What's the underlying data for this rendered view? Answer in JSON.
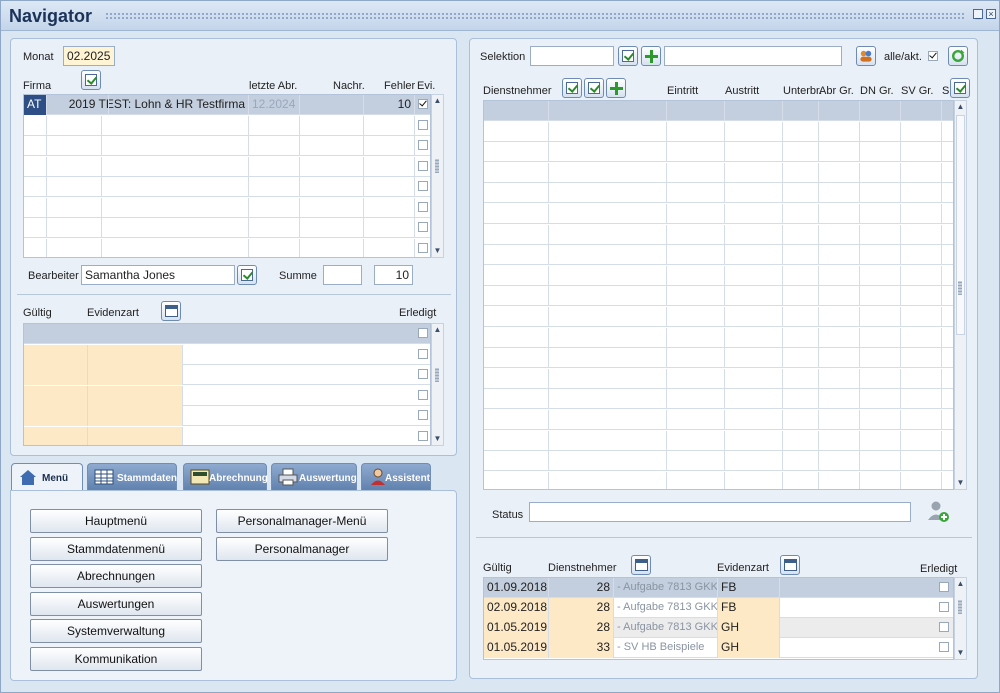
{
  "window": {
    "title": "Navigator"
  },
  "left_top": {
    "monat_label": "Monat",
    "monat_value": "02.2025",
    "columns": {
      "firma": "Firma",
      "letzte_abr": "letzte Abr.",
      "nachr": "Nachr.",
      "fehler": "Fehler",
      "evi": "Evi."
    },
    "rows": [
      {
        "land": "AT",
        "name": "2019 TEST: Lohn & HR Testfirma",
        "letzte_abr": "12.2024",
        "nachr": "",
        "fehler": "10",
        "evi_checked": true
      }
    ],
    "bearbeiter_label": "Bearbeiter",
    "bearbeiter_value": "Samantha Jones",
    "summe_label": "Summe",
    "summe_value": "",
    "summe_fehler": "10"
  },
  "left_mid": {
    "columns": {
      "gueltig": "Gültig",
      "evidenzart": "Evidenzart",
      "erledigt": "Erledigt"
    }
  },
  "tabs": [
    {
      "label": "Menü",
      "icon": "home-icon",
      "active": true
    },
    {
      "label": "Stammdaten",
      "icon": "table-icon",
      "active": false
    },
    {
      "label": "Abrechnung",
      "icon": "calculator-icon",
      "active": false
    },
    {
      "label": "Auswertung",
      "icon": "printer-icon",
      "active": false
    },
    {
      "label": "Assistent",
      "icon": "person-icon",
      "active": false
    }
  ],
  "menu": {
    "col1": [
      "Hauptmenü",
      "Stammdatenmenü",
      "Abrechnungen",
      "Auswertungen",
      "Systemverwaltung",
      "Kommunikation"
    ],
    "col2": [
      "Personalmanager-Menü",
      "Personalmanager"
    ]
  },
  "right_top": {
    "selektion_label": "Selektion",
    "selektion_value": "",
    "selektion_text": "",
    "alle_akt_label": "alle/akt.",
    "alle_akt_checked": true,
    "columns": {
      "dienstnehmer": "Dienstnehmer",
      "eintritt": "Eintritt",
      "austritt": "Austritt",
      "unterbr": "Unterbr.",
      "abr_gr": "Abr Gr.",
      "dn_gr": "DN Gr.",
      "sv_gr": "SV Gr.",
      "s": "S"
    },
    "status_label": "Status",
    "status_value": ""
  },
  "right_bottom": {
    "columns": {
      "gueltig": "Gültig",
      "dienstnehmer": "Dienstnehmer",
      "evidenzart": "Evidenzart",
      "erledigt": "Erledigt"
    },
    "rows": [
      {
        "gueltig": "01.09.2018",
        "nr": "28",
        "name": "- Aufgabe 7813 GKK",
        "art": "FB",
        "erledigt": false
      },
      {
        "gueltig": "02.09.2018",
        "nr": "28",
        "name": "- Aufgabe 7813 GKK",
        "art": "FB",
        "erledigt": false
      },
      {
        "gueltig": "01.05.2019",
        "nr": "28",
        "name": "- Aufgabe 7813 GKK",
        "art": "GH",
        "erledigt": false
      },
      {
        "gueltig": "01.05.2019",
        "nr": "33",
        "name": "- SV HB Beispiele",
        "art": "GH",
        "erledigt": false
      }
    ]
  }
}
